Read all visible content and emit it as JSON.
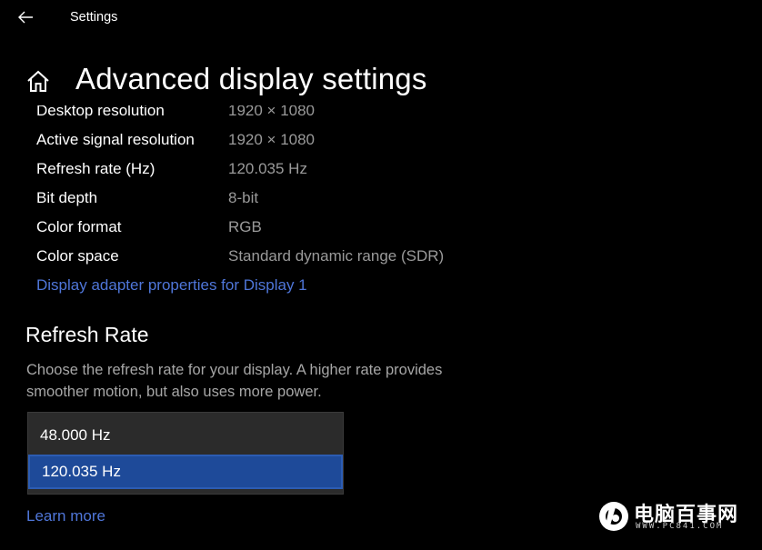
{
  "window": {
    "title": "Settings",
    "icons": {
      "back": "back-arrow-icon"
    }
  },
  "header": {
    "title": "Advanced display settings",
    "icons": {
      "home": "home-icon"
    }
  },
  "display_info": {
    "rows": [
      {
        "label": "Desktop resolution",
        "value": "1920 × 1080"
      },
      {
        "label": "Active signal resolution",
        "value": "1920 × 1080"
      },
      {
        "label": "Refresh rate (Hz)",
        "value": "120.035 Hz"
      },
      {
        "label": "Bit depth",
        "value": "8-bit"
      },
      {
        "label": "Color format",
        "value": "RGB"
      },
      {
        "label": "Color space",
        "value": "Standard dynamic range (SDR)"
      }
    ],
    "adapter_link": "Display adapter properties for Display 1"
  },
  "refresh_rate": {
    "title": "Refresh Rate",
    "description": "Choose the refresh rate for your display. A higher rate provides smoother motion, but also uses more power.",
    "options": [
      "48.000 Hz",
      "120.035 Hz"
    ],
    "selected": "120.035 Hz",
    "learn_more": "Learn more"
  },
  "watermark": {
    "text": "电脑百事网",
    "url": "WWW.PC841.COM",
    "icon": "pc841-logo-icon"
  },
  "colors": {
    "background": "#000000",
    "link": "#4f76d9",
    "secondary_text": "#9a9a9a",
    "dropdown_bg": "#2b2b2b",
    "selected_option": "#1e4a99"
  }
}
